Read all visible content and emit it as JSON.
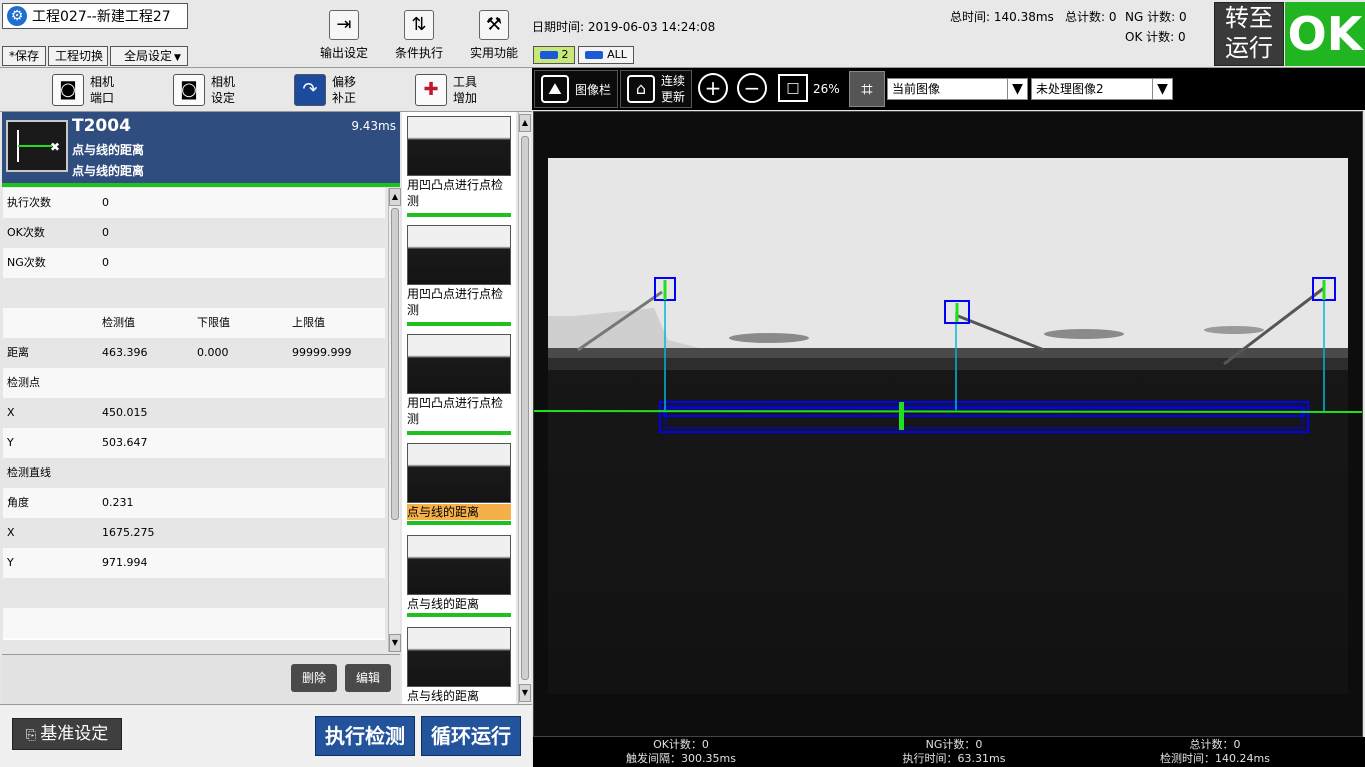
{
  "header": {
    "project_title": "工程027--新建工程27",
    "menu": [
      "*保存",
      "工程切换",
      "全局设定"
    ],
    "tools": [
      {
        "label": "输出设定",
        "icon": "output-settings-icon"
      },
      {
        "label": "条件执行",
        "icon": "conditional-exec-icon"
      },
      {
        "label": "实用功能",
        "icon": "utility-icon"
      }
    ],
    "datetime": "日期时间: 2019-06-03 14:24:08",
    "total_time": "总时间: 140.38ms",
    "total_count": "总计数: 0",
    "ng_count": "NG 计数: 0",
    "ok_count": "OK 计数: 0",
    "camera_tab": "2",
    "camera_all": "ALL",
    "run_button": [
      "转至",
      "运行"
    ],
    "status": "OK",
    "status_color": "#22b522"
  },
  "left_toolbar": [
    {
      "line1": "相机",
      "line2": "端口",
      "icon": "camera-port-icon"
    },
    {
      "line1": "相机",
      "line2": "设定",
      "icon": "camera-settings-icon"
    },
    {
      "line1": "偏移",
      "line2": "补正",
      "icon": "offset-correction-icon"
    },
    {
      "line1": "工具",
      "line2": "增加",
      "icon": "add-tool-icon"
    }
  ],
  "tool": {
    "id": "T2004",
    "time": "9.43ms",
    "name": "点与线的距离",
    "subname": "点与线的距离"
  },
  "params": [
    [
      "执行次数",
      "0",
      "",
      ""
    ],
    [
      "OK次数",
      "0",
      "",
      ""
    ],
    [
      "NG次数",
      "0",
      "",
      ""
    ],
    [
      "",
      "",
      "",
      ""
    ],
    [
      "",
      "检测值",
      "下限值",
      "上限值"
    ],
    [
      "距离",
      "463.396",
      "0.000",
      "99999.999"
    ],
    [
      "检测点",
      "",
      "",
      ""
    ],
    [
      "X",
      "450.015",
      "",
      ""
    ],
    [
      "Y",
      "503.647",
      "",
      ""
    ],
    [
      "检测直线",
      "",
      "",
      ""
    ],
    [
      "角度",
      "0.231",
      "",
      ""
    ],
    [
      "X",
      "1675.275",
      "",
      ""
    ],
    [
      "Y",
      "971.994",
      "",
      ""
    ],
    [
      "",
      "",
      "",
      ""
    ],
    [
      "",
      "",
      "",
      ""
    ]
  ],
  "buttons": {
    "delete": "删除",
    "edit": "编辑",
    "reference": "基准设定",
    "execute": "执行检测",
    "loop": "循环运行"
  },
  "thumbnails": [
    {
      "label": "用凹凸点进行点检测",
      "selected": false
    },
    {
      "label": "用凹凸点进行点检测",
      "selected": false
    },
    {
      "label": "用凹凸点进行点检测",
      "selected": false
    },
    {
      "label": "点与线的距离",
      "selected": true
    },
    {
      "label": "点与线的距离",
      "selected": false
    },
    {
      "label": "点与线的距离",
      "selected": false
    }
  ],
  "image_toolbar": {
    "gallery": "图像栏",
    "continuous_line1": "连续",
    "continuous_line2": "更新",
    "zoom": "26%",
    "image_source": "当前图像",
    "image_select": "未处理图像2"
  },
  "footer": {
    "ok_count": "OK计数：0",
    "trigger_interval": "触发间隔：300.35ms",
    "ng_count": "NG计数：0",
    "exec_time": "执行时间：63.31ms",
    "total_count": "总计数：0",
    "detect_time": "检测时间：140.24ms"
  }
}
